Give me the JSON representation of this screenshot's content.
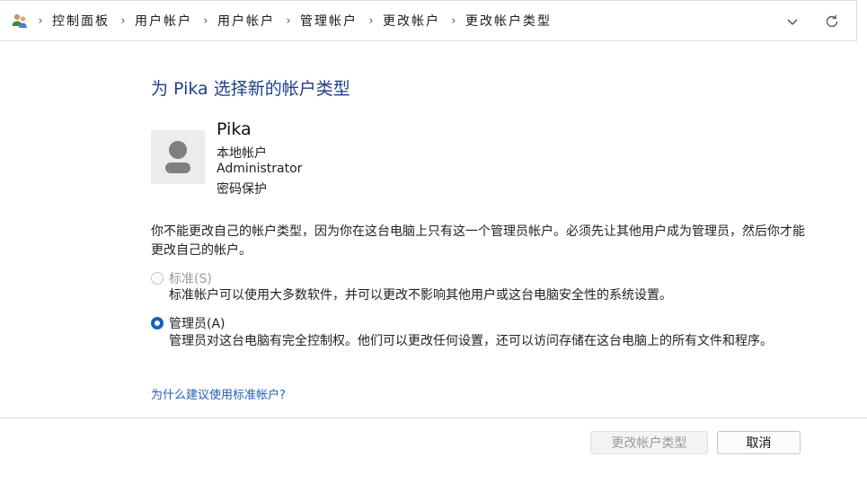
{
  "address_bar": {
    "icon": "control-panel-users-icon",
    "breadcrumbs": [
      "控制面板",
      "用户帐户",
      "用户帐户",
      "管理帐户",
      "更改帐户",
      "更改帐户类型"
    ]
  },
  "page": {
    "title": "为 Pika 选择新的帐户类型",
    "user": {
      "name": "Pika",
      "lines": [
        "本地帐户",
        "Administrator",
        "密码保护"
      ]
    },
    "description": "你不能更改自己的帐户类型，因为你在这台电脑上只有这一个管理员帐户。必须先让其他用户成为管理员，然后你才能更改自己的帐户。",
    "options": [
      {
        "label": "标准(S)",
        "description": "标准帐户可以使用大多数软件，并可以更改不影响其他用户或这台电脑安全性的系统设置。",
        "checked": false,
        "disabled": true
      },
      {
        "label": "管理员(A)",
        "description": "管理员对这台电脑有完全控制权。他们可以更改任何设置，还可以访问存储在这台电脑上的所有文件和程序。",
        "checked": true,
        "disabled": false
      }
    ],
    "help_link": "为什么建议使用标准帐户?"
  },
  "footer": {
    "change_button": "更改帐户类型",
    "cancel_button": "取消"
  },
  "colors": {
    "title": "#1e3f88",
    "link": "#1e5fb5",
    "radio_accent": "#1062c5"
  }
}
